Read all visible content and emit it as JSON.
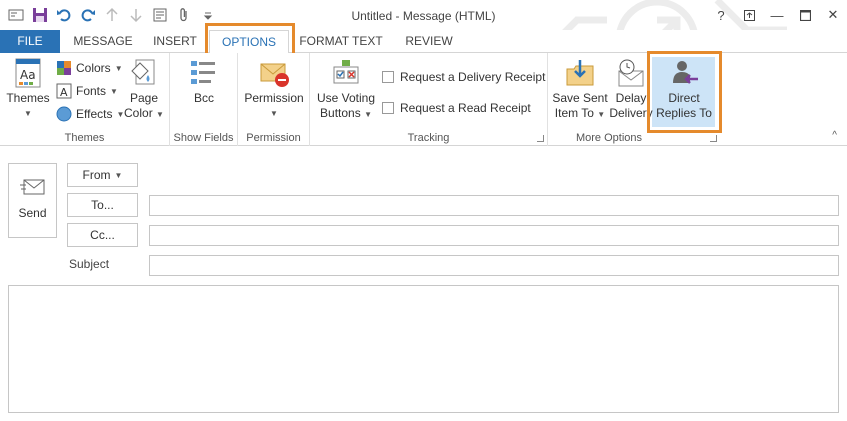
{
  "window": {
    "title": "Untitled - Message (HTML)",
    "help_label": "?",
    "minimize_label": "—",
    "close_label": "✕"
  },
  "tabs": [
    {
      "label": "FILE"
    },
    {
      "label": "MESSAGE"
    },
    {
      "label": "INSERT"
    },
    {
      "label": "OPTIONS"
    },
    {
      "label": "FORMAT TEXT"
    },
    {
      "label": "REVIEW"
    }
  ],
  "ribbon": {
    "themes": {
      "themes_label": "Themes",
      "colors_label": "Colors",
      "fonts_label": "Fonts",
      "effects_label": "Effects",
      "page_color_line1": "Page",
      "page_color_line2": "Color",
      "group_label": "Themes"
    },
    "show_fields": {
      "bcc_label": "Bcc",
      "group_label": "Show Fields"
    },
    "permission": {
      "permission_label": "Permission",
      "group_label": "Permission"
    },
    "tracking": {
      "voting_line1": "Use Voting",
      "voting_line2": "Buttons",
      "delivery_receipt_label": "Request a Delivery Receipt",
      "read_receipt_label": "Request a Read Receipt",
      "group_label": "Tracking"
    },
    "more_options": {
      "save_sent_line1": "Save Sent",
      "save_sent_line2": "Item To",
      "delay_line1": "Delay",
      "delay_line2": "Delivery",
      "direct_line1": "Direct",
      "direct_line2": "Replies To",
      "group_label": "More Options"
    },
    "collapse_label": "^"
  },
  "compose": {
    "send_label": "Send",
    "from_label": "From",
    "to_label": "To...",
    "cc_label": "Cc...",
    "subject_label": "Subject",
    "to_value": "",
    "cc_value": "",
    "subject_value": "",
    "body_value": ""
  }
}
